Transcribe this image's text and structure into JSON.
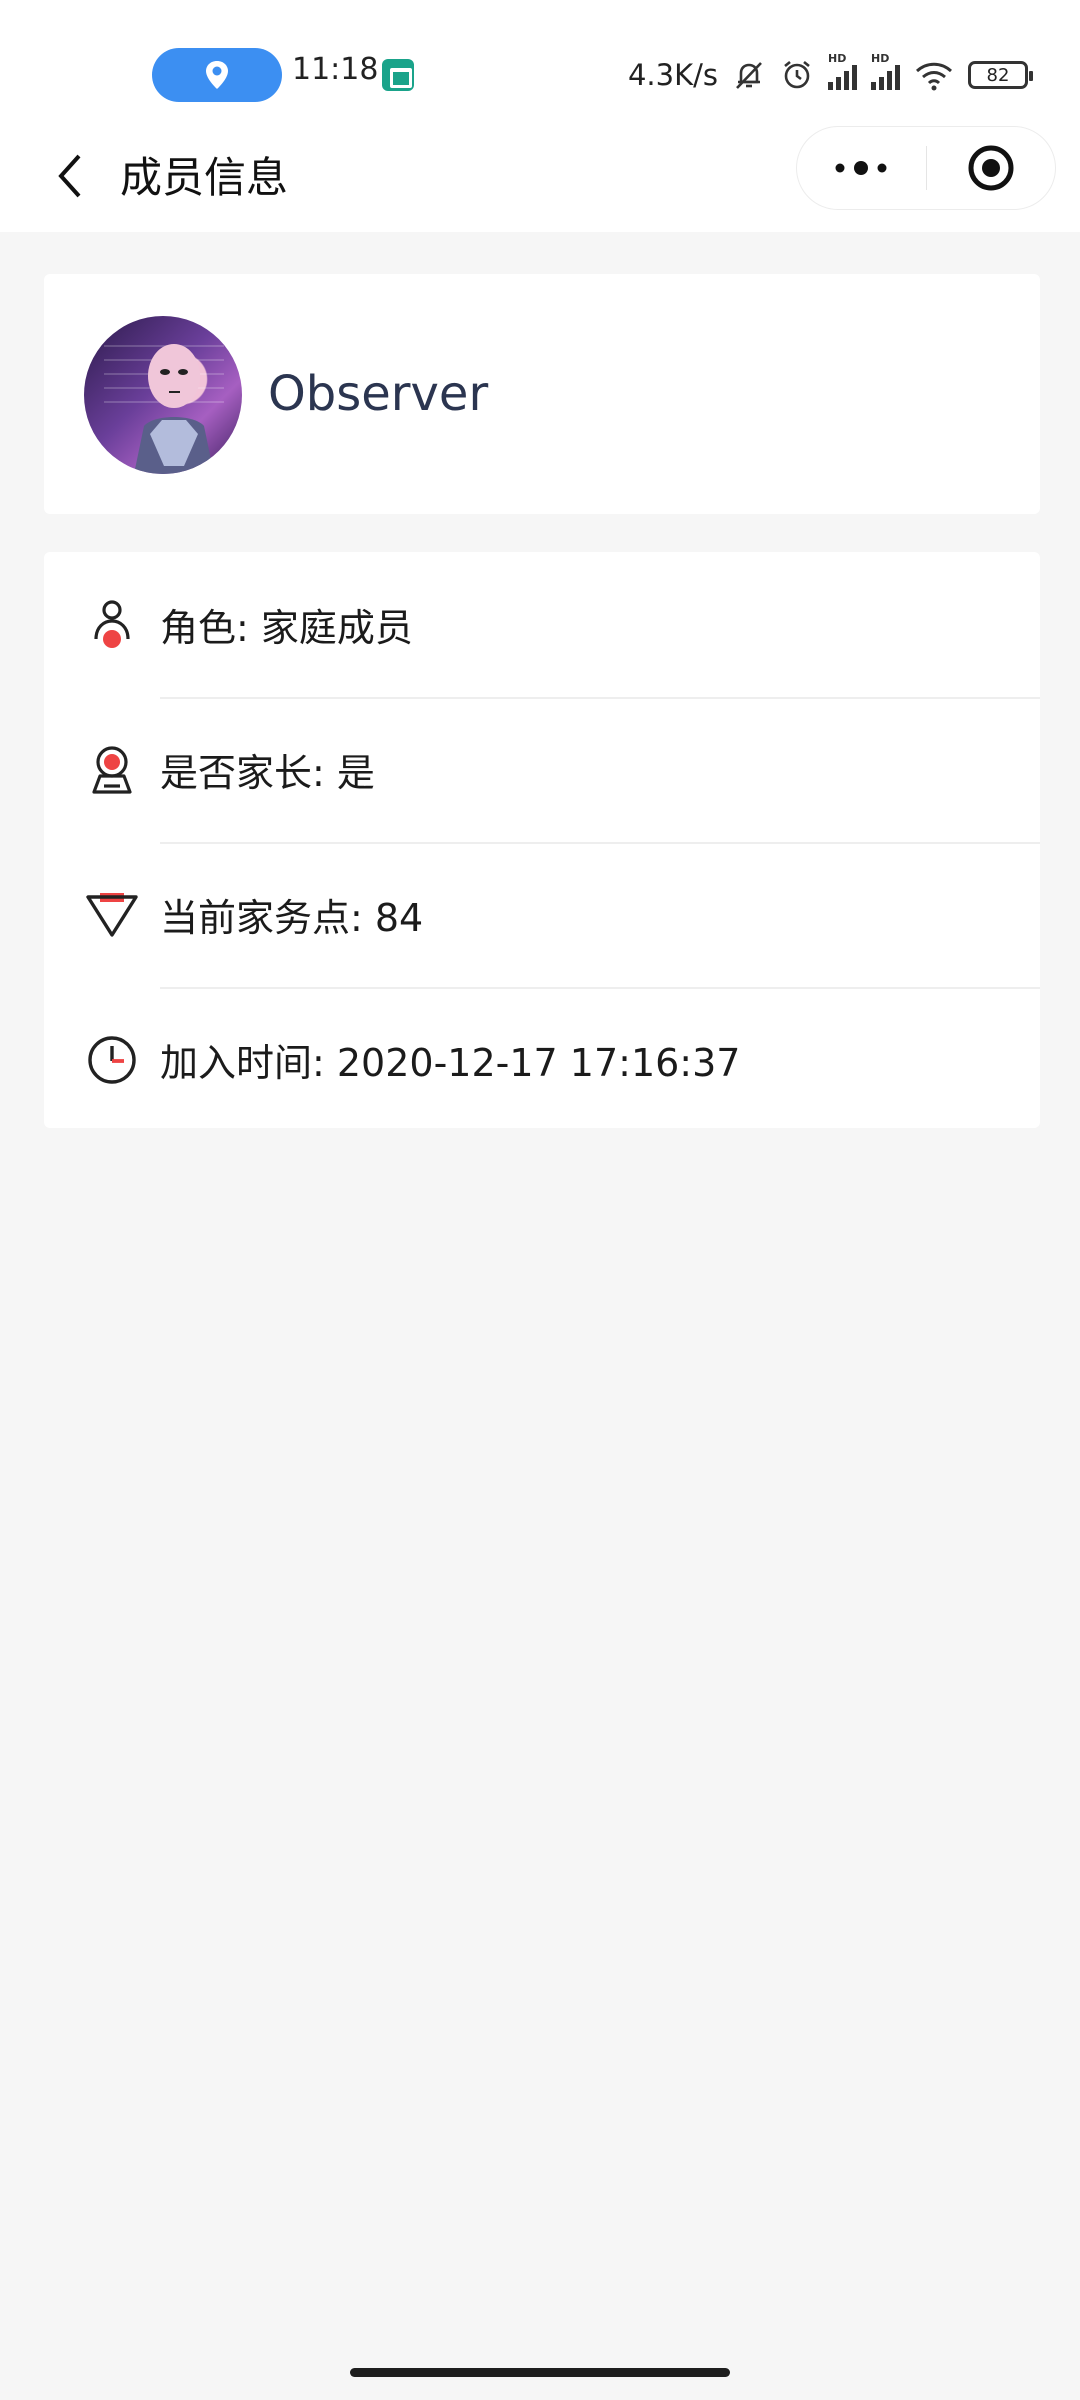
{
  "status_bar": {
    "time": "11:18",
    "net_speed": "4.3K/s",
    "hd_label": "HD",
    "battery": "82",
    "icons": [
      "location-icon",
      "app-notification-icon",
      "mute-bell-icon",
      "alarm-icon",
      "signal-icon",
      "wifi-icon",
      "battery-icon"
    ]
  },
  "nav": {
    "title": "成员信息",
    "back_icon": "chevron-left-icon",
    "menu_icon": "more-dots-icon",
    "close_icon": "target-circle-icon"
  },
  "profile": {
    "name": "Observer"
  },
  "info": {
    "rows": [
      {
        "icon": "person-icon",
        "text": "角色: 家庭成员"
      },
      {
        "icon": "parent-badge-icon",
        "text": "是否家长: 是"
      },
      {
        "icon": "diamond-icon",
        "text": "当前家务点: 84"
      },
      {
        "icon": "clock-icon",
        "text": "加入时间: 2020-12-17 17:16:37"
      }
    ]
  },
  "colors": {
    "accent_red": "#ee4444",
    "pill_blue": "#3c8ff2",
    "icon_dark": "#333333",
    "page_bg": "#f6f6f6"
  }
}
